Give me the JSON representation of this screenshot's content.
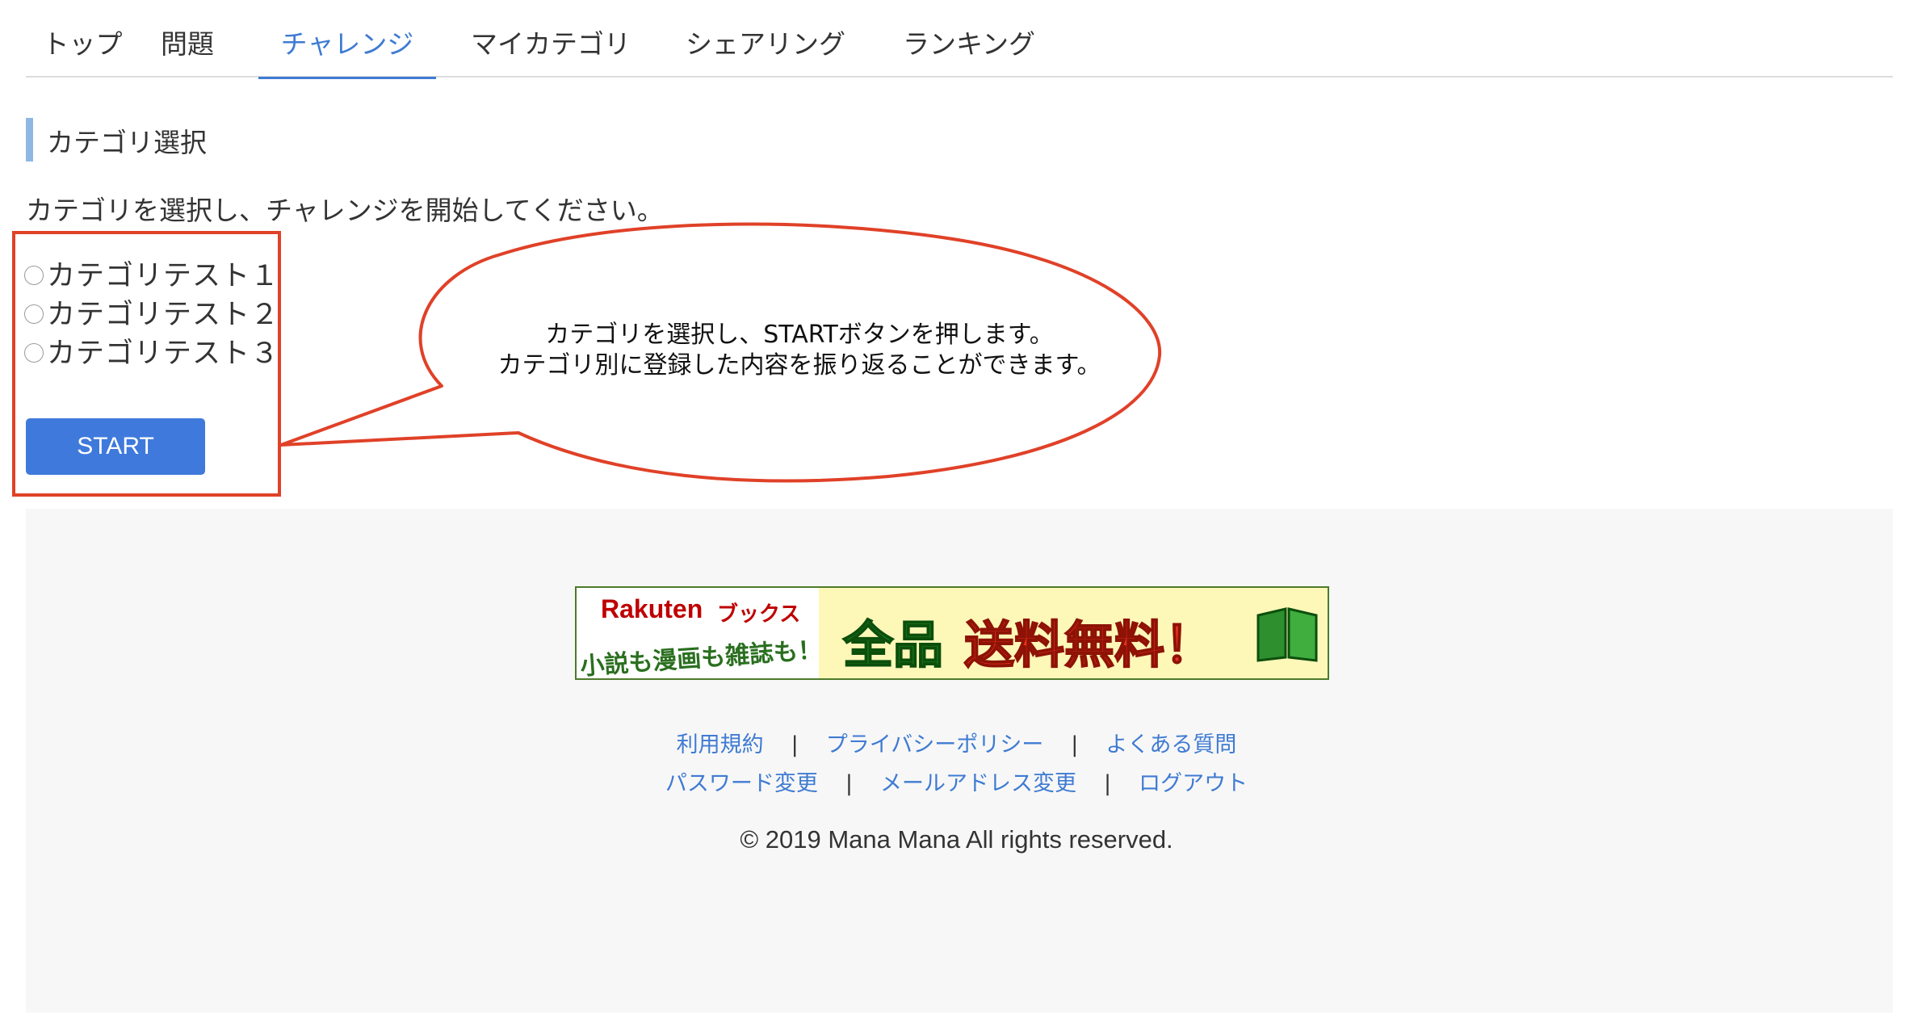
{
  "tabs": [
    {
      "label": "トップ",
      "active": false
    },
    {
      "label": "問題",
      "active": false
    },
    {
      "label": "チャレンジ",
      "active": true
    },
    {
      "label": "マイカテゴリ",
      "active": false
    },
    {
      "label": "シェアリング",
      "active": false
    },
    {
      "label": "ランキング",
      "active": false
    }
  ],
  "section": {
    "title": "カテゴリ選択",
    "instruction": "カテゴリを選択し、チャレンジを開始してください。"
  },
  "categories": [
    {
      "label": "カテゴリテスト１",
      "selected": false
    },
    {
      "label": "カテゴリテスト２",
      "selected": false
    },
    {
      "label": "カテゴリテスト３",
      "selected": false
    }
  ],
  "start_button": {
    "label": "START"
  },
  "callout": {
    "line1": "カテゴリを選択し、STARTボタンを押します。",
    "line2": "カテゴリ別に登録した内容を振り返ることができます。",
    "color": "#e04128"
  },
  "banner": {
    "brand": "Rakuten",
    "brand_sub": "ブックス",
    "tagline": "小説も漫画も雑誌も！",
    "headline_1": "全品",
    "headline_2": "送料無料！",
    "icon": "book-icon"
  },
  "footer": {
    "links_row1": [
      "利用規約",
      "プライバシーポリシー",
      "よくある質問"
    ],
    "links_row2": [
      "パスワード変更",
      "メールアドレス変更",
      "ログアウト"
    ],
    "separator": "|",
    "copyright": "© 2019 Mana Mana All rights reserved."
  },
  "colors": {
    "accent": "#3f7bd3",
    "button": "#3f79dc",
    "footer_bg": "#f7f7f7",
    "annotation": "#e04128"
  }
}
